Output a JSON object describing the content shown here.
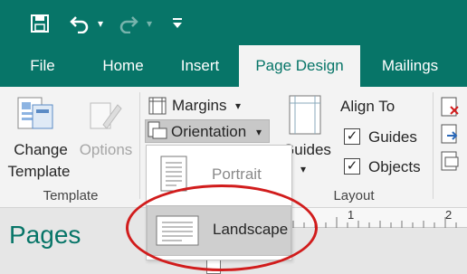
{
  "quick_access": {
    "save_icon": "save-icon",
    "undo_icon": "undo-icon",
    "redo_icon": "redo-icon",
    "customize_icon": "customize-qat-icon",
    "dropdown_glyph": "▾"
  },
  "tabs": [
    {
      "label": "File"
    },
    {
      "label": "Home"
    },
    {
      "label": "Insert"
    },
    {
      "label": "Page Design",
      "active": true
    },
    {
      "label": "Mailings"
    }
  ],
  "ribbon": {
    "template_group": {
      "change_template_line1": "Change",
      "change_template_line2": "Template",
      "options_label": "Options",
      "group_label": "Template"
    },
    "margins_label": "Margins",
    "orientation_label": "Orientation",
    "guides_label": "Guides",
    "align_to_label": "Align To",
    "align_guides": {
      "label": "Guides",
      "checked": true
    },
    "align_objects": {
      "label": "Objects",
      "checked": true
    },
    "layout_group_label": "Layout",
    "dropdown_arrow": "▾",
    "check_mark": "✓"
  },
  "orientation_menu": {
    "items": [
      {
        "label": "Portrait",
        "selected": false
      },
      {
        "label": "Landscape",
        "selected": true
      }
    ]
  },
  "pages_pane": {
    "title": "Pages"
  },
  "ruler": {
    "marks": [
      "1",
      "2"
    ]
  },
  "colors": {
    "accent": "#077568",
    "annotation": "#d11c1c"
  }
}
